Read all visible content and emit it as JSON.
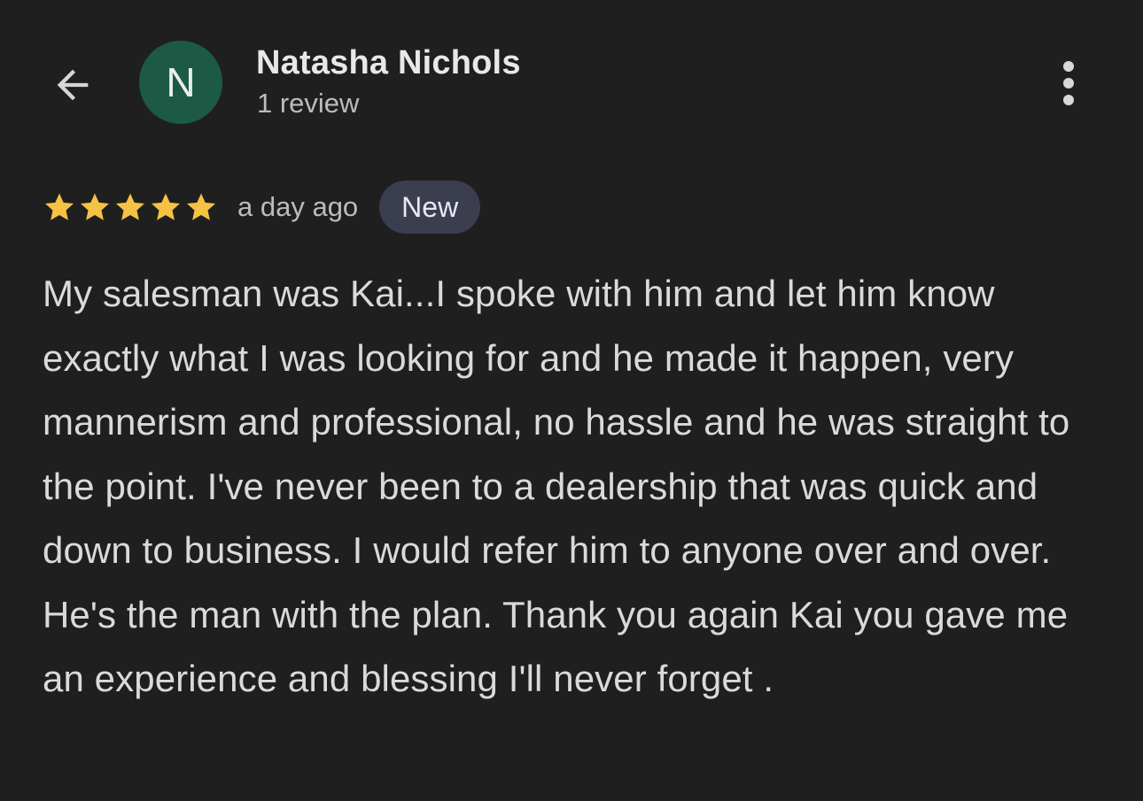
{
  "header": {
    "back_icon": "arrow-left-icon",
    "avatar_initial": "N",
    "avatar_color": "#1d5a45",
    "user_name": "Natasha Nichols",
    "review_count": "1 review",
    "more_icon": "more-vertical-icon"
  },
  "review": {
    "rating": 5,
    "rating_max": 5,
    "star_color": "#f6c244",
    "star_icon": "star-icon",
    "time_ago": "a day ago",
    "badge": "New",
    "badge_color": "#3b3e4f",
    "text": "My salesman was Kai...I spoke with him and let him know exactly what I was looking for and he made it happen, very mannerism and professional, no hassle and he was straight to the point. I've never been to a dealership that was quick and down to business. I would refer him to anyone over and over. He's the man with the plan. Thank you again Kai you gave me an experience and blessing I'll never forget ."
  },
  "colors": {
    "background": "#1f1f1f",
    "primary_text": "#e3e3e3",
    "secondary_text": "#bcbcbc"
  }
}
